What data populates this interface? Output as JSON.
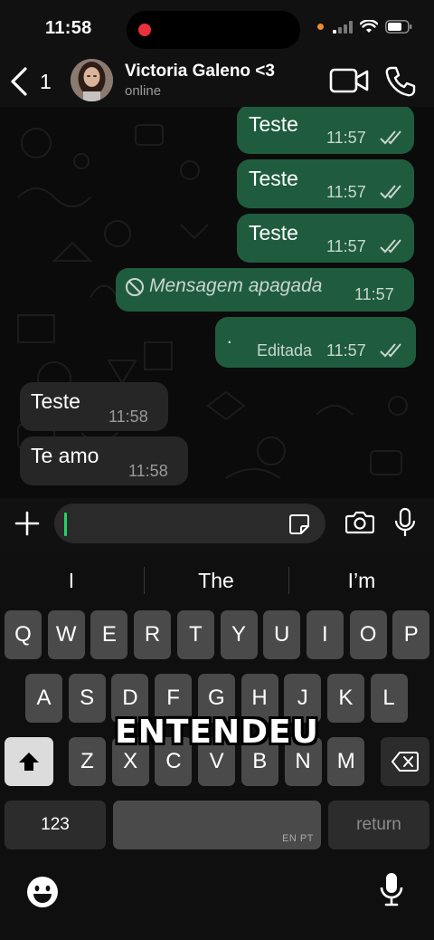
{
  "status_bar": {
    "time": "11:58"
  },
  "header": {
    "back_count": "1",
    "contact_name": "Victoria Galeno <3",
    "contact_status": "online"
  },
  "messages": [
    {
      "direction": "outgoing",
      "text": "Teste",
      "time": "11:57",
      "read": true
    },
    {
      "direction": "outgoing",
      "text": "Teste",
      "time": "11:57",
      "read": true
    },
    {
      "direction": "outgoing",
      "text": "Teste",
      "time": "11:57",
      "read": true
    },
    {
      "direction": "outgoing",
      "deleted_text": "Mensagem apagada",
      "time": "11:57"
    },
    {
      "direction": "outgoing",
      "text": ".",
      "edited_label": "Editada",
      "time": "11:57",
      "read": true
    },
    {
      "direction": "incoming",
      "text": "Teste",
      "time": "11:58"
    },
    {
      "direction": "incoming",
      "text": "Te amo",
      "time": "11:58"
    }
  ],
  "composer": {
    "value": "",
    "icons": [
      "plus-icon",
      "sticker-icon",
      "camera-icon",
      "mic-icon"
    ]
  },
  "keyboard": {
    "suggestions": [
      "I",
      "The",
      "I’m"
    ],
    "row1": [
      "Q",
      "W",
      "E",
      "R",
      "T",
      "Y",
      "U",
      "I",
      "O",
      "P"
    ],
    "row2": [
      "A",
      "S",
      "D",
      "F",
      "G",
      "H",
      "J",
      "K",
      "L"
    ],
    "row3": [
      "Z",
      "X",
      "C",
      "V",
      "B",
      "N",
      "M"
    ],
    "numbers_label": "123",
    "space_language": "EN PT",
    "return_label": "return"
  },
  "overlay_caption": "ENTENDEU",
  "colors": {
    "outgoing_bubble": "#1f5c3e",
    "incoming_bubble": "#262626",
    "read_check": "#c9d6ce",
    "caret": "#25d366"
  }
}
